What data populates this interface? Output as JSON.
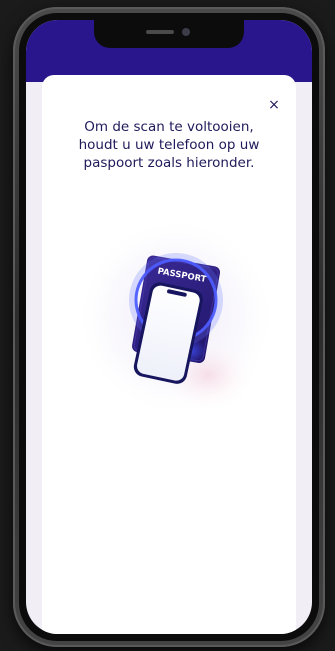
{
  "modal": {
    "close_label": "×",
    "instruction": "Om de scan te voltooien, houdt u uw telefoon op uw paspoort zoals hieronder."
  },
  "illustration": {
    "passport_label": "PASSPORT",
    "icon": "phone-on-passport-icon"
  },
  "colors": {
    "brand_header": "#2a168c",
    "text": "#1e1a5a",
    "passport": "#2a1d7a",
    "glow": "#4d5cff"
  }
}
